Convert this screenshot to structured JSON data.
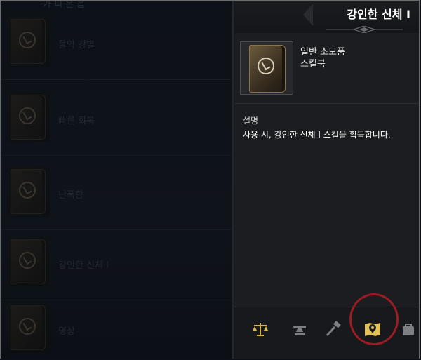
{
  "left_list": {
    "top_fragment": "가 디 은 음",
    "items": [
      {
        "name": "물약 강별"
      },
      {
        "name": "빠른 회복"
      },
      {
        "name": "난폭함"
      },
      {
        "name": "강인한 신체 I"
      },
      {
        "name": "명상"
      }
    ]
  },
  "detail": {
    "title": "강인한 신체 I",
    "type_line1": "일반 소모품",
    "type_line2": "스킬북",
    "description_label": "설명",
    "description": "사용 시, 강인한 신체 I 스킬을 획득합니다."
  },
  "footer_icons": [
    "scales-icon",
    "anvil-icon",
    "hammer-icon",
    "map-pin-icon",
    "bag-icon"
  ],
  "colors": {
    "accent_gold": "#d8b54a",
    "highlight_circle": "#9b1c22"
  }
}
